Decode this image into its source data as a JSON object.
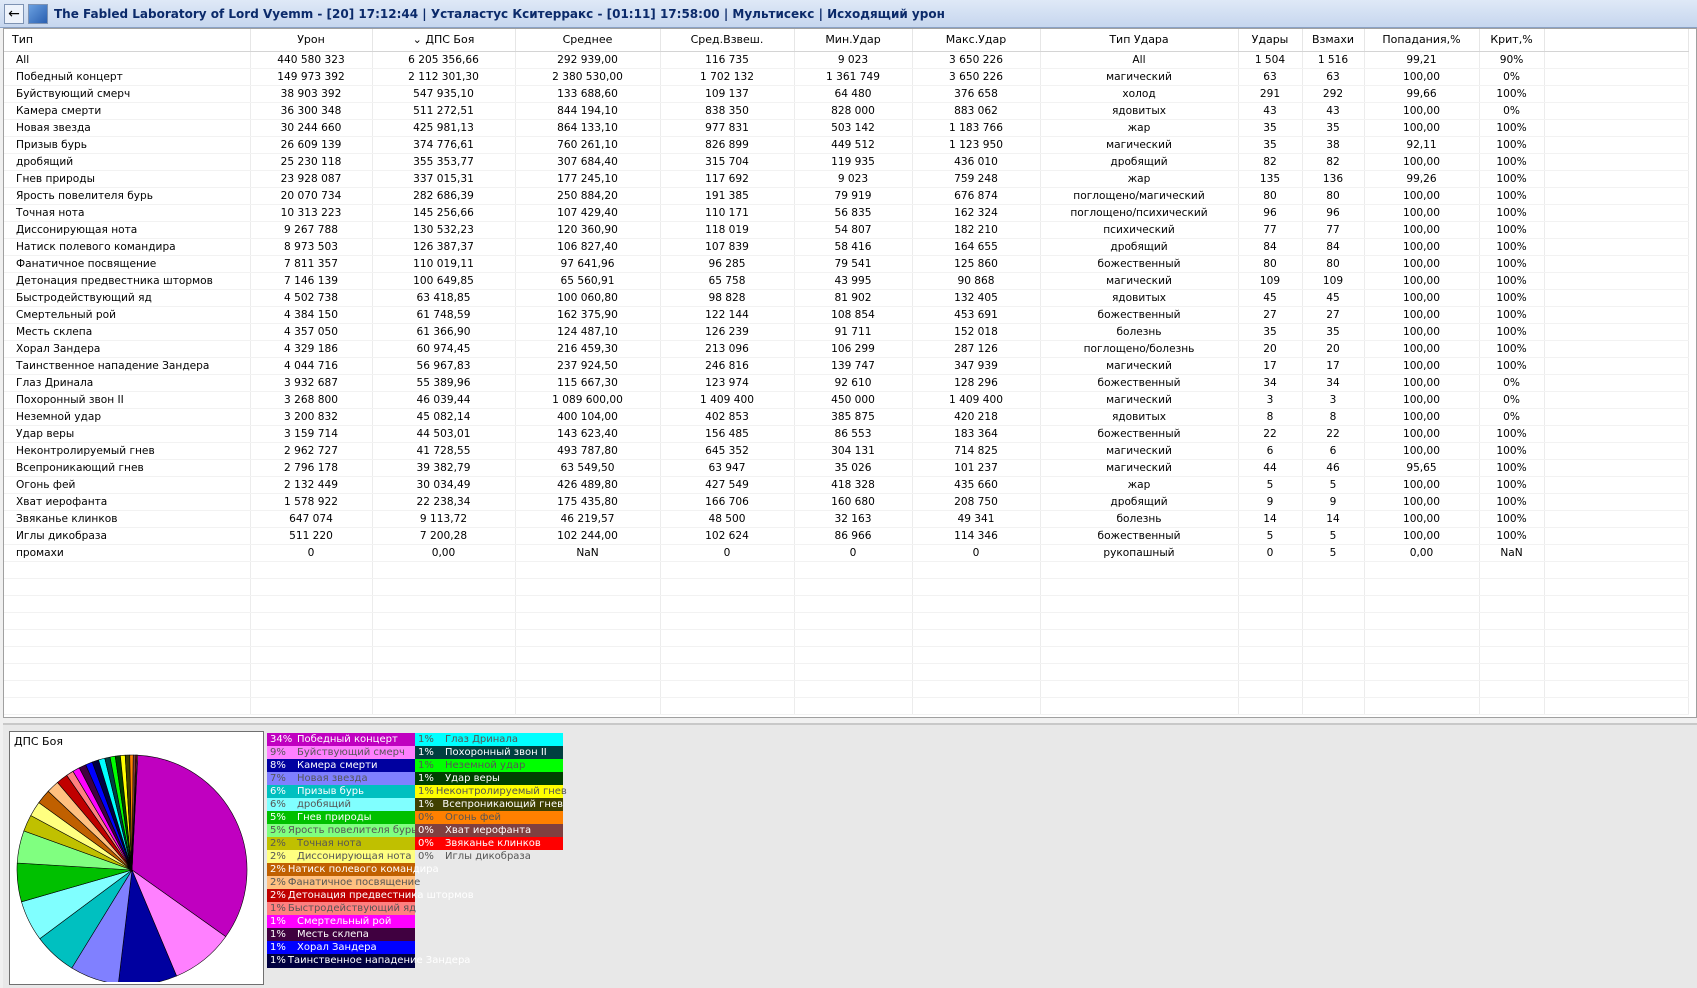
{
  "window": {
    "title": "The Fabled Laboratory of Lord Vyemm - [20] 17:12:44 | Усталастус Кситерракс - [01:11] 17:58:00 | Мультисекс | Исходящий урон"
  },
  "columns": [
    "Тип",
    "Урон",
    "ДПС Боя",
    "Среднее",
    "Сред.Взвеш.",
    "Мин.Удар",
    "Макс.Удар",
    "Тип Удара",
    "Удары",
    "Взмахи",
    "Попадания,%",
    "Крит,%"
  ],
  "sort_indicator": "⌄",
  "rows": [
    [
      "All",
      "440 580 323",
      "6 205 356,66",
      "292 939,00",
      "116 735",
      "9 023",
      "3 650 226",
      "All",
      "1 504",
      "1 516",
      "99,21",
      "90%"
    ],
    [
      "Победный концерт",
      "149 973 392",
      "2 112 301,30",
      "2 380 530,00",
      "1 702 132",
      "1 361 749",
      "3 650 226",
      "магический",
      "63",
      "63",
      "100,00",
      "0%"
    ],
    [
      "Буйствующий смерч",
      "38 903 392",
      "547 935,10",
      "133 688,60",
      "109 137",
      "64 480",
      "376 658",
      "холод",
      "291",
      "292",
      "99,66",
      "100%"
    ],
    [
      "Камера смерти",
      "36 300 348",
      "511 272,51",
      "844 194,10",
      "838 350",
      "828 000",
      "883 062",
      "ядовитых",
      "43",
      "43",
      "100,00",
      "0%"
    ],
    [
      "Новая звезда",
      "30 244 660",
      "425 981,13",
      "864 133,10",
      "977 831",
      "503 142",
      "1 183 766",
      "жар",
      "35",
      "35",
      "100,00",
      "100%"
    ],
    [
      "Призыв бурь",
      "26 609 139",
      "374 776,61",
      "760 261,10",
      "826 899",
      "449 512",
      "1 123 950",
      "магический",
      "35",
      "38",
      "92,11",
      "100%"
    ],
    [
      "дробящий",
      "25 230 118",
      "355 353,77",
      "307 684,40",
      "315 704",
      "119 935",
      "436 010",
      "дробящий",
      "82",
      "82",
      "100,00",
      "100%"
    ],
    [
      "Гнев природы",
      "23 928 087",
      "337 015,31",
      "177 245,10",
      "117 692",
      "9 023",
      "759 248",
      "жар",
      "135",
      "136",
      "99,26",
      "100%"
    ],
    [
      "Ярость повелителя бурь",
      "20 070 734",
      "282 686,39",
      "250 884,20",
      "191 385",
      "79 919",
      "676 874",
      "поглощено/магический",
      "80",
      "80",
      "100,00",
      "100%"
    ],
    [
      "Точная нота",
      "10 313 223",
      "145 256,66",
      "107 429,40",
      "110 171",
      "56 835",
      "162 324",
      "поглощено/психический",
      "96",
      "96",
      "100,00",
      "100%"
    ],
    [
      "Диссонирующая нота",
      "9 267 788",
      "130 532,23",
      "120 360,90",
      "118 019",
      "54 807",
      "182 210",
      "психический",
      "77",
      "77",
      "100,00",
      "100%"
    ],
    [
      "Натиск полевого командира",
      "8 973 503",
      "126 387,37",
      "106 827,40",
      "107 839",
      "58 416",
      "164 655",
      "дробящий",
      "84",
      "84",
      "100,00",
      "100%"
    ],
    [
      "Фанатичное посвящение",
      "7 811 357",
      "110 019,11",
      "97 641,96",
      "96 285",
      "79 541",
      "125 860",
      "божественный",
      "80",
      "80",
      "100,00",
      "100%"
    ],
    [
      "Детонация предвестника штормов",
      "7 146 139",
      "100 649,85",
      "65 560,91",
      "65 758",
      "43 995",
      "90 868",
      "магический",
      "109",
      "109",
      "100,00",
      "100%"
    ],
    [
      "Быстродействующий яд",
      "4 502 738",
      "63 418,85",
      "100 060,80",
      "98 828",
      "81 902",
      "132 405",
      "ядовитых",
      "45",
      "45",
      "100,00",
      "100%"
    ],
    [
      "Смертельный рой",
      "4 384 150",
      "61 748,59",
      "162 375,90",
      "122 144",
      "108 854",
      "453 691",
      "божественный",
      "27",
      "27",
      "100,00",
      "100%"
    ],
    [
      "Месть склепа",
      "4 357 050",
      "61 366,90",
      "124 487,10",
      "126 239",
      "91 711",
      "152 018",
      "болезнь",
      "35",
      "35",
      "100,00",
      "100%"
    ],
    [
      "Хорал Зандера",
      "4 329 186",
      "60 974,45",
      "216 459,30",
      "213 096",
      "106 299",
      "287 126",
      "поглощено/болезнь",
      "20",
      "20",
      "100,00",
      "100%"
    ],
    [
      "Таинственное нападение Зандера",
      "4 044 716",
      "56 967,83",
      "237 924,50",
      "246 816",
      "139 747",
      "347 939",
      "магический",
      "17",
      "17",
      "100,00",
      "100%"
    ],
    [
      "Глаз Дринала",
      "3 932 687",
      "55 389,96",
      "115 667,30",
      "123 974",
      "92 610",
      "128 296",
      "божественный",
      "34",
      "34",
      "100,00",
      "0%"
    ],
    [
      "Похоронный звон II",
      "3 268 800",
      "46 039,44",
      "1 089 600,00",
      "1 409 400",
      "450 000",
      "1 409 400",
      "магический",
      "3",
      "3",
      "100,00",
      "0%"
    ],
    [
      "Неземной удар",
      "3 200 832",
      "45 082,14",
      "400 104,00",
      "402 853",
      "385 875",
      "420 218",
      "ядовитых",
      "8",
      "8",
      "100,00",
      "0%"
    ],
    [
      "Удар веры",
      "3 159 714",
      "44 503,01",
      "143 623,40",
      "156 485",
      "86 553",
      "183 364",
      "божественный",
      "22",
      "22",
      "100,00",
      "100%"
    ],
    [
      "Неконтролируемый гнев",
      "2 962 727",
      "41 728,55",
      "493 787,80",
      "645 352",
      "304 131",
      "714 825",
      "магический",
      "6",
      "6",
      "100,00",
      "100%"
    ],
    [
      "Всепроникающий гнев",
      "2 796 178",
      "39 382,79",
      "63 549,50",
      "63 947",
      "35 026",
      "101 237",
      "магический",
      "44",
      "46",
      "95,65",
      "100%"
    ],
    [
      "Огонь фей",
      "2 132 449",
      "30 034,49",
      "426 489,80",
      "427 549",
      "418 328",
      "435 660",
      "жар",
      "5",
      "5",
      "100,00",
      "100%"
    ],
    [
      "Хват иерофанта",
      "1 578 922",
      "22 238,34",
      "175 435,80",
      "166 706",
      "160 680",
      "208 750",
      "дробящий",
      "9",
      "9",
      "100,00",
      "100%"
    ],
    [
      "Звяканье клинков",
      "647 074",
      "9 113,72",
      "46 219,57",
      "48 500",
      "32 163",
      "49 341",
      "болезнь",
      "14",
      "14",
      "100,00",
      "100%"
    ],
    [
      "Иглы дикобраза",
      "511 220",
      "7 200,28",
      "102 244,00",
      "102 624",
      "86 966",
      "114 346",
      "божественный",
      "5",
      "5",
      "100,00",
      "100%"
    ],
    [
      "промахи",
      "0",
      "0,00",
      "NaN",
      "0",
      "0",
      "0",
      "рукопашный",
      "0",
      "5",
      "0,00",
      "NaN"
    ]
  ],
  "chart_data": {
    "type": "pie",
    "title": "ДПС Боя",
    "slices": [
      {
        "label": "Победный концерт",
        "pct": "34%",
        "value": 2112301.3,
        "color": "#c000c0"
      },
      {
        "label": "Буйствующий смерч",
        "pct": "9%",
        "value": 547935.1,
        "color": "#ff80ff"
      },
      {
        "label": "Камера смерти",
        "pct": "8%",
        "value": 511272.51,
        "color": "#0000a0"
      },
      {
        "label": "Новая звезда",
        "pct": "7%",
        "value": 425981.13,
        "color": "#8080ff"
      },
      {
        "label": "Призыв бурь",
        "pct": "6%",
        "value": 374776.61,
        "color": "#00c0c0"
      },
      {
        "label": "дробящий",
        "pct": "6%",
        "value": 355353.77,
        "color": "#80ffff"
      },
      {
        "label": "Гнев природы",
        "pct": "5%",
        "value": 337015.31,
        "color": "#00c000"
      },
      {
        "label": "Ярость повелителя бурь",
        "pct": "5%",
        "value": 282686.39,
        "color": "#80ff80"
      },
      {
        "label": "Точная нота",
        "pct": "2%",
        "value": 145256.66,
        "color": "#c0c000"
      },
      {
        "label": "Диссонирующая нота",
        "pct": "2%",
        "value": 130532.23,
        "color": "#ffff80"
      },
      {
        "label": "Натиск полевого командира",
        "pct": "2%",
        "value": 126387.37,
        "color": "#c06000"
      },
      {
        "label": "Фанатичное посвящение",
        "pct": "2%",
        "value": 110019.11,
        "color": "#ffc080"
      },
      {
        "label": "Детонация предвестника штормов",
        "pct": "2%",
        "value": 100649.85,
        "color": "#c00000"
      },
      {
        "label": "Быстродействующий яд",
        "pct": "1%",
        "value": 63418.85,
        "color": "#ff8080"
      },
      {
        "label": "Смертельный рой",
        "pct": "1%",
        "value": 61748.59,
        "color": "#ff00ff"
      },
      {
        "label": "Месть склепа",
        "pct": "1%",
        "value": 61366.9,
        "color": "#400040"
      },
      {
        "label": "Хорал Зандера",
        "pct": "1%",
        "value": 60974.45,
        "color": "#0000ff"
      },
      {
        "label": "Таинственное нападение Зандера",
        "pct": "1%",
        "value": 56967.83,
        "color": "#000040"
      },
      {
        "label": "Глаз Дринала",
        "pct": "1%",
        "value": 55389.96,
        "color": "#00ffff"
      },
      {
        "label": "Похоронный звон II",
        "pct": "1%",
        "value": 46039.44,
        "color": "#004040"
      },
      {
        "label": "Неземной удар",
        "pct": "1%",
        "value": 45082.14,
        "color": "#00ff00"
      },
      {
        "label": "Удар веры",
        "pct": "1%",
        "value": 44503.01,
        "color": "#004000"
      },
      {
        "label": "Неконтролируемый гнев",
        "pct": "1%",
        "value": 41728.55,
        "color": "#ffff00"
      },
      {
        "label": "Всепроникающий гнев",
        "pct": "1%",
        "value": 39382.79,
        "color": "#404000"
      },
      {
        "label": "Огонь фей",
        "pct": "0%",
        "value": 30034.49,
        "color": "#ff8000"
      },
      {
        "label": "Хват иерофанта",
        "pct": "0%",
        "value": 22238.34,
        "color": "#804040"
      },
      {
        "label": "Звяканье клинков",
        "pct": "0%",
        "value": 9113.72,
        "color": "#ff0000"
      },
      {
        "label": "Иглы дикобраза",
        "pct": "0%",
        "value": 7200.28,
        "color": "#e8e8e8"
      }
    ]
  }
}
